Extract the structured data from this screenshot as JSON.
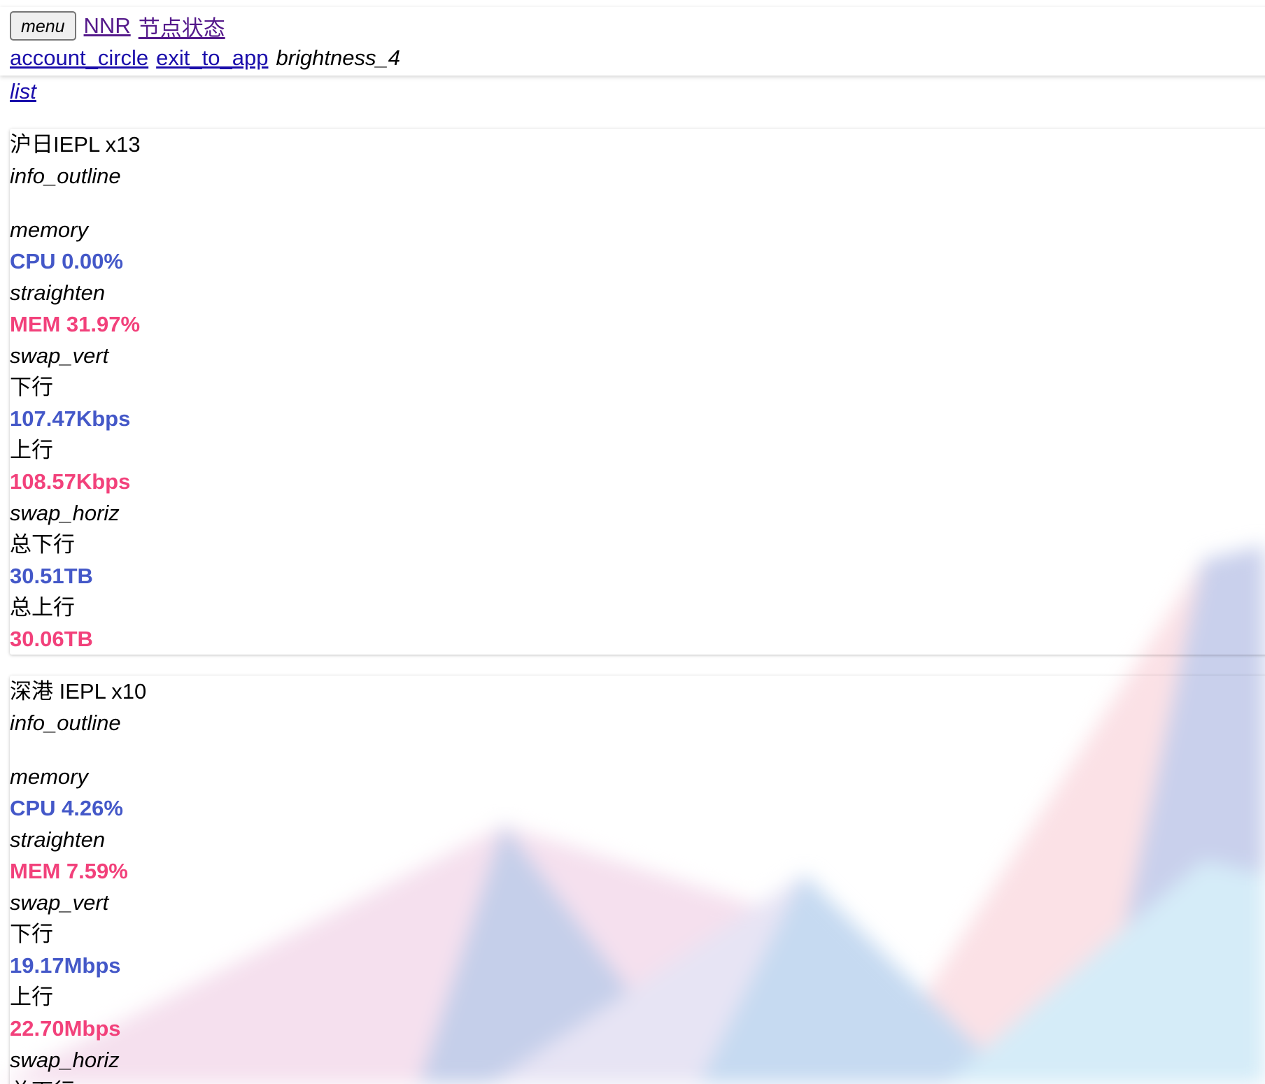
{
  "header": {
    "menu_label": "menu",
    "brand": "NNR",
    "nav_title": "节点状态",
    "account_icon": "account_circle",
    "exit_icon": "exit_to_app",
    "theme_icon": "brightness_4",
    "list_icon": "list"
  },
  "nodes": [
    {
      "name": "沪日IEPL x13",
      "info_icon": "info_outline",
      "cpu_icon": "memory",
      "cpu": "CPU 0.00%",
      "mem_icon": "straighten",
      "mem": "MEM 31.97%",
      "speed_icon": "swap_vert",
      "down_label": "下行",
      "down": "107.47Kbps",
      "up_label": "上行",
      "up": "108.57Kbps",
      "total_icon": "swap_horiz",
      "total_down_label": "总下行",
      "total_down": "30.51TB",
      "total_up_label": "总上行",
      "total_up": "30.06TB"
    },
    {
      "name": "深港 IEPL x10",
      "info_icon": "info_outline",
      "cpu_icon": "memory",
      "cpu": "CPU 4.26%",
      "mem_icon": "straighten",
      "mem": "MEM 7.59%",
      "speed_icon": "swap_vert",
      "down_label": "下行",
      "down": "19.17Mbps",
      "up_label": "上行",
      "up": "22.70Mbps",
      "total_icon": "swap_horiz",
      "total_down_label": "总下行"
    }
  ],
  "colors": {
    "blue": "#4458c8",
    "pink": "#f2417b",
    "link": "#1a0dab",
    "visited": "#551a8b"
  }
}
